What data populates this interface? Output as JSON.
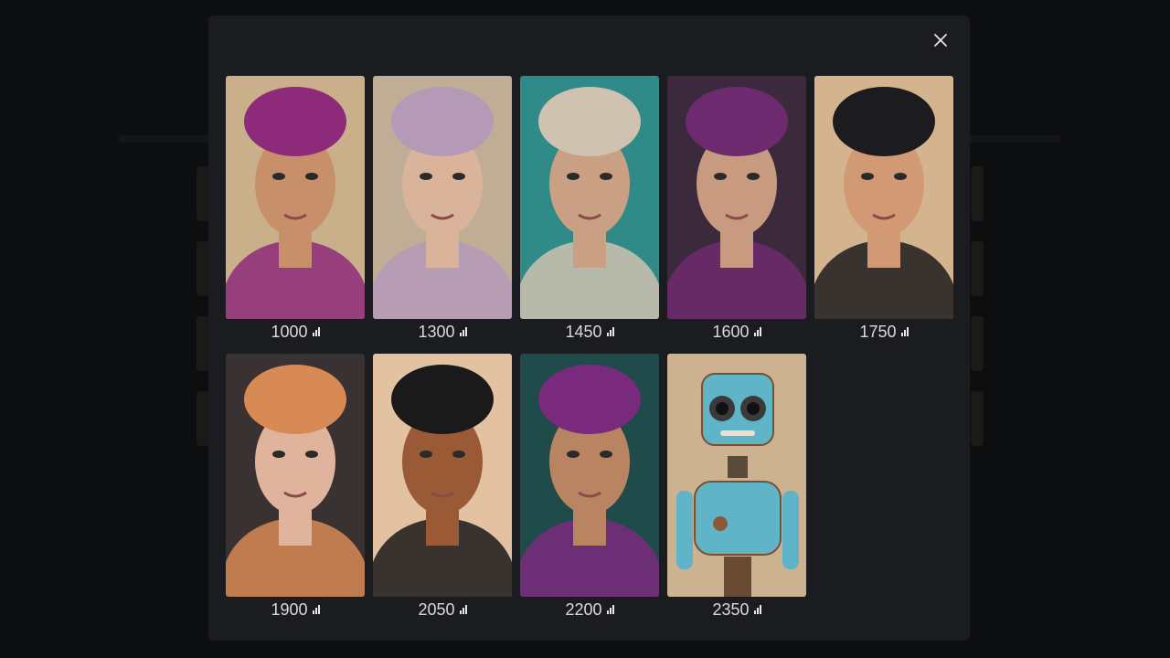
{
  "modal": {
    "close_icon": "close-icon",
    "items": [
      {
        "value": "1000",
        "subject": "child in purple knit hat and teal scarf",
        "bg": "#c9b08a",
        "accent": "#8e2a7a",
        "skin": "#c8906a"
      },
      {
        "value": "1300",
        "subject": "woman with lavender veil and berries",
        "bg": "#bfae95",
        "accent": "#b59ab8",
        "skin": "#d9b39a"
      },
      {
        "value": "1450",
        "subject": "man in sequined flat cap",
        "bg": "#2f8a88",
        "accent": "#cfc2b0",
        "skin": "#caa085"
      },
      {
        "value": "1600",
        "subject": "older woman in purple headscarf",
        "bg": "#3a2a3c",
        "accent": "#6e2a6e",
        "skin": "#c89a80"
      },
      {
        "value": "1750",
        "subject": "boy in dark coat",
        "bg": "#d4b48e",
        "accent": "#1c1c1e",
        "skin": "#d19a74"
      },
      {
        "value": "1900",
        "subject": "woman in floral hat and fur coat",
        "bg": "#3a3232",
        "accent": "#d88a55",
        "skin": "#e0b49c"
      },
      {
        "value": "2050",
        "subject": "smiling boy in black t-shirt",
        "bg": "#e2c2a0",
        "accent": "#1a1a1a",
        "skin": "#9b5a36"
      },
      {
        "value": "2200",
        "subject": "person with purple curly hair and yellow glasses",
        "bg": "#1f4c4a",
        "accent": "#7a2a7c",
        "skin": "#b98462"
      },
      {
        "value": "2350",
        "subject": "rusty blue robot",
        "bg": "#cdb292",
        "accent": "#5fb4c8",
        "skin": "#5fb4c8"
      }
    ]
  }
}
